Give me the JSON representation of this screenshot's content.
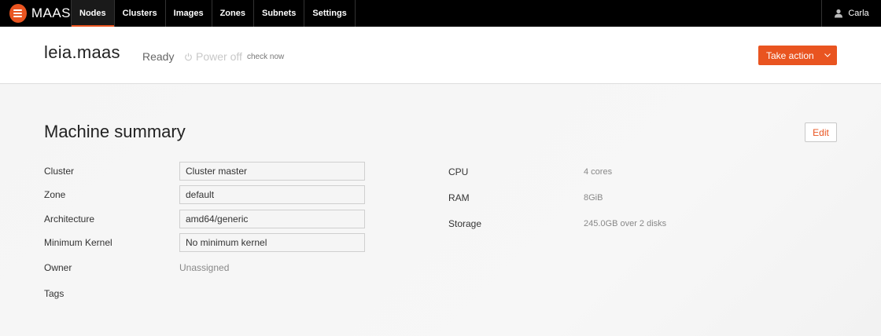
{
  "brand": {
    "name": "MAAS"
  },
  "nav": {
    "items": [
      {
        "label": "Nodes"
      },
      {
        "label": "Clusters"
      },
      {
        "label": "Images"
      },
      {
        "label": "Zones"
      },
      {
        "label": "Subnets"
      },
      {
        "label": "Settings"
      }
    ],
    "active": "Nodes"
  },
  "user": {
    "name": "Carla"
  },
  "header": {
    "node_name": "leia.maas",
    "status": "Ready",
    "power": "Power off",
    "check_now": "check now",
    "take_action": "Take action"
  },
  "summary": {
    "title": "Machine summary",
    "edit": "Edit",
    "fields": {
      "cluster": {
        "label": "Cluster",
        "value": "Cluster master"
      },
      "zone": {
        "label": "Zone",
        "value": "default"
      },
      "architecture": {
        "label": "Architecture",
        "value": "amd64/generic"
      },
      "min_kernel": {
        "label": "Minimum Kernel",
        "value": "No minimum kernel"
      },
      "owner": {
        "label": "Owner",
        "value": "Unassigned"
      },
      "tags": {
        "label": "Tags"
      }
    },
    "specs": {
      "cpu": {
        "label": "CPU",
        "value": "4 cores"
      },
      "ram": {
        "label": "RAM",
        "value": "8GiB"
      },
      "storage": {
        "label": "Storage",
        "value": "245.0GB over 2 disks"
      }
    }
  },
  "colors": {
    "accent": "#e95420",
    "topbar": "#000000"
  },
  "icons": {
    "brand": "maas-logo-icon",
    "power": "power-icon",
    "user": "user-icon",
    "chevron": "chevron-down-icon"
  }
}
